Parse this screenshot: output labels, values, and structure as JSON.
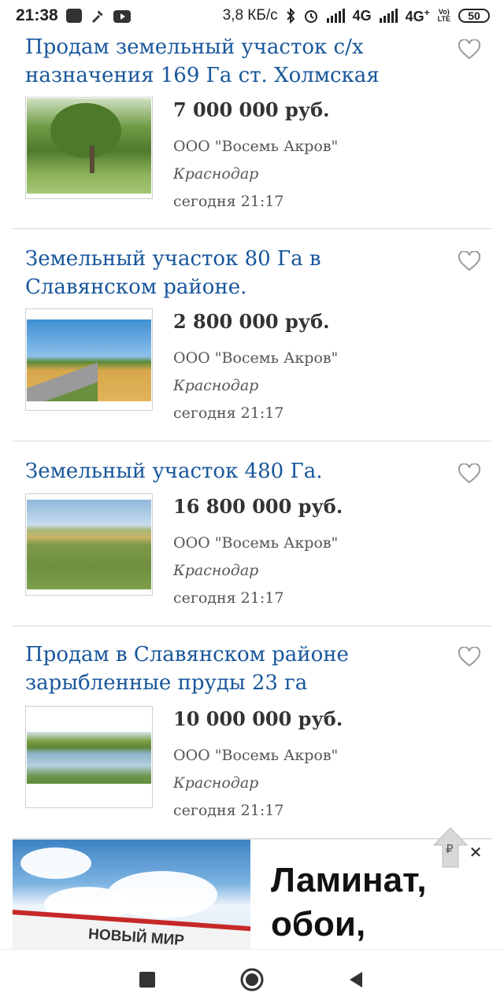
{
  "status_bar": {
    "time": "21:38",
    "net_speed": "3,8 КБ/с",
    "net1": "4G",
    "net2": "4G",
    "net2_sup": "+",
    "volte_top": "Vo)",
    "volte_bottom": "LTE",
    "battery": "50",
    "icons": [
      "message-icon",
      "tools-icon",
      "youtube-icon",
      "bluetooth-icon",
      "alarm-icon",
      "signal-icon"
    ]
  },
  "listings": [
    {
      "title": "Продам земельный участок с/х назначения 169 Га ст. Холмская",
      "price": "7 000 000 руб.",
      "seller": "ООО \"Восемь Акров\"",
      "city": "Краснодар",
      "date": "сегодня 21:17"
    },
    {
      "title": "Земельный участок 80 Га в Славянском районе.",
      "price": "2 800 000 руб.",
      "seller": "ООО \"Восемь Акров\"",
      "city": "Краснодар",
      "date": "сегодня 21:17"
    },
    {
      "title": "Земельный участок 480 Га.",
      "price": "16 800 000 руб.",
      "seller": "ООО \"Восемь Акров\"",
      "city": "Краснодар",
      "date": "сегодня 21:17"
    },
    {
      "title": "Продам в Славянском районе зарыбленные пруды 23 га",
      "price": "10 000 000 руб.",
      "seller": "ООО \"Восемь Акров\"",
      "city": "Краснодар",
      "date": "сегодня 21:17"
    }
  ],
  "ad": {
    "headline": "Ламинат, обои,",
    "store_sign": "НОВЫЙ МИР",
    "badge_symbol": "₽",
    "close": "✕"
  },
  "colors": {
    "title": "#17569b",
    "price": "#333333",
    "meta": "#555555"
  }
}
